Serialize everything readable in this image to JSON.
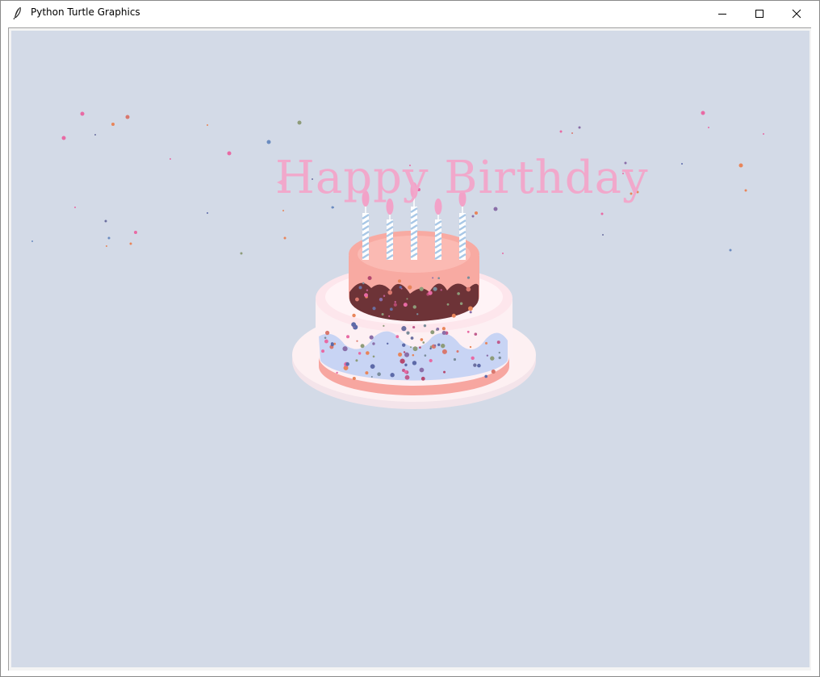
{
  "window": {
    "title": "Python Turtle Graphics",
    "icon": "feather-icon",
    "controls": {
      "minimize": "minimize-icon",
      "maximize": "maximize-icon",
      "close": "close-icon"
    }
  },
  "canvas": {
    "background": "#d3dae7",
    "headline": "Happy Birthday",
    "headline_color": "#f1a8cb",
    "cake": {
      "candle_count": 5,
      "colors": {
        "plate": "#fdf0f2",
        "bottom_tier": "#fdf0f3",
        "bottom_band": "#f7a6a0",
        "bottom_frosting": "#c8d4f4",
        "top_tier": "#f8aaa2",
        "top_surface": "#fbbab3",
        "chocolate": "#6d3337",
        "candle_stripe": "#a8c7e6",
        "flame": "#f2a2c8"
      }
    }
  }
}
